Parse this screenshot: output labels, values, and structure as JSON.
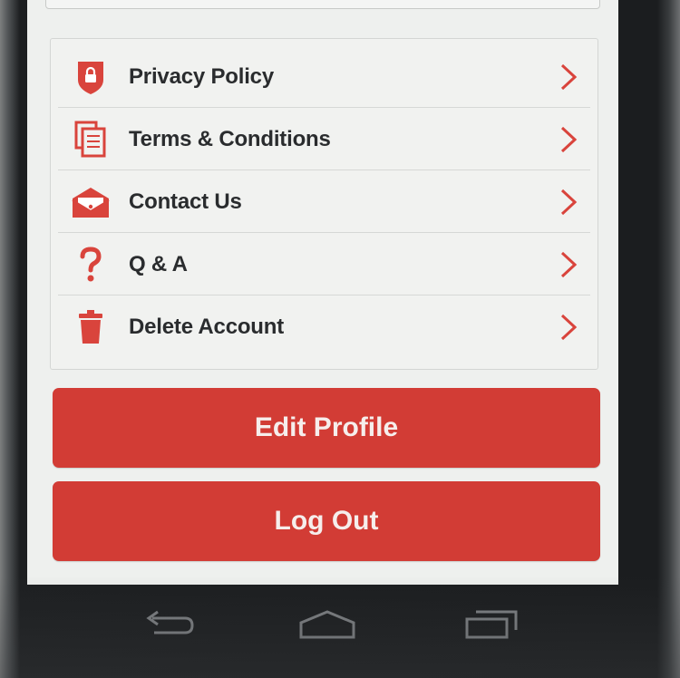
{
  "menu": {
    "items": [
      {
        "label": "Privacy Policy",
        "icon": "shield-lock-icon"
      },
      {
        "label": "Terms & Conditions",
        "icon": "documents-icon"
      },
      {
        "label": "Contact Us",
        "icon": "envelope-icon"
      },
      {
        "label": "Q & A",
        "icon": "question-mark-icon"
      },
      {
        "label": "Delete Account",
        "icon": "trash-icon"
      }
    ],
    "chevron_icon": "chevron-right-icon"
  },
  "buttons": {
    "edit_profile": "Edit Profile",
    "log_out": "Log Out"
  },
  "navigation": {
    "back_icon": "back-icon",
    "home_icon": "home-icon",
    "recents_icon": "recent-apps-icon"
  },
  "colors": {
    "accent": "#d23c35",
    "icon": "#d9443c",
    "text": "#2a2c2e",
    "background": "#eef0ee"
  }
}
